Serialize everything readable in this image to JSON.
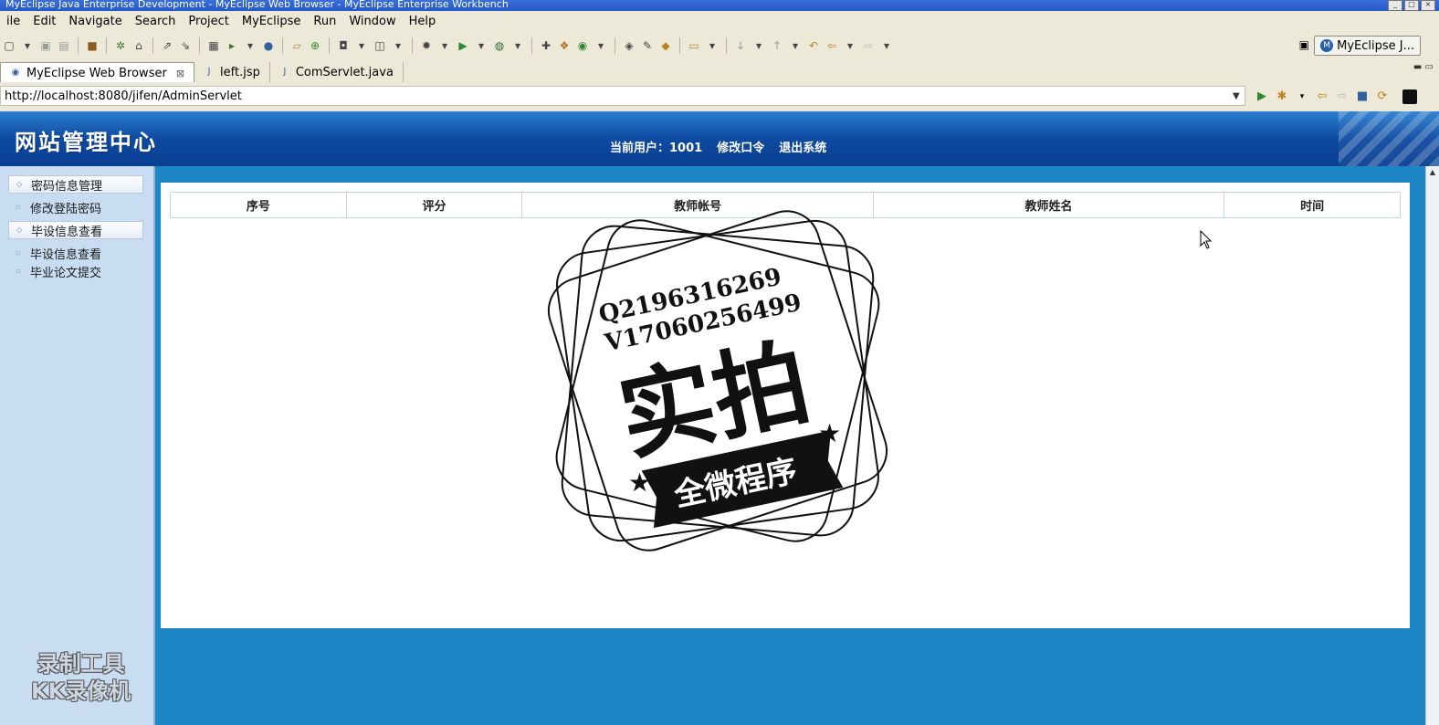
{
  "window": {
    "title": "MyEclipse Java Enterprise Development - MyEclipse Web Browser - MyEclipse Enterprise Workbench"
  },
  "menu": [
    "ile",
    "Edit",
    "Navigate",
    "Search",
    "Project",
    "MyEclipse",
    "Run",
    "Window",
    "Help"
  ],
  "perspective": {
    "label": "MyEclipse J..."
  },
  "tabs": [
    {
      "label": "MyEclipse Web Browser",
      "active": true
    },
    {
      "label": "left.jsp"
    },
    {
      "label": "ComServlet.java"
    }
  ],
  "address": {
    "url": "http://localhost:8080/jifen/AdminServlet"
  },
  "site": {
    "title": "网站管理中心",
    "current_user": "当前用户：1001",
    "change_password": "修改口令",
    "logout": "退出系统"
  },
  "sidebar": {
    "items": [
      {
        "label": "密码信息管理",
        "type": "category"
      },
      {
        "label": "修改登陆密码",
        "type": "sub"
      },
      {
        "label": "毕设信息查看",
        "type": "category"
      },
      {
        "label": "毕设信息查看",
        "type": "sub"
      },
      {
        "label": "毕业论文提交",
        "type": "sub"
      }
    ]
  },
  "table": {
    "columns": [
      "序号",
      "评分",
      "教师帐号",
      "教师姓名",
      "时间"
    ],
    "rows": []
  },
  "watermarks": {
    "recorder_line1": "录制工具",
    "recorder_line2": "KK录像机",
    "stamp_qq": "Q2196316269",
    "stamp_wechat": "V17060256499",
    "stamp_main": "实拍",
    "stamp_banner": "全微程序"
  }
}
